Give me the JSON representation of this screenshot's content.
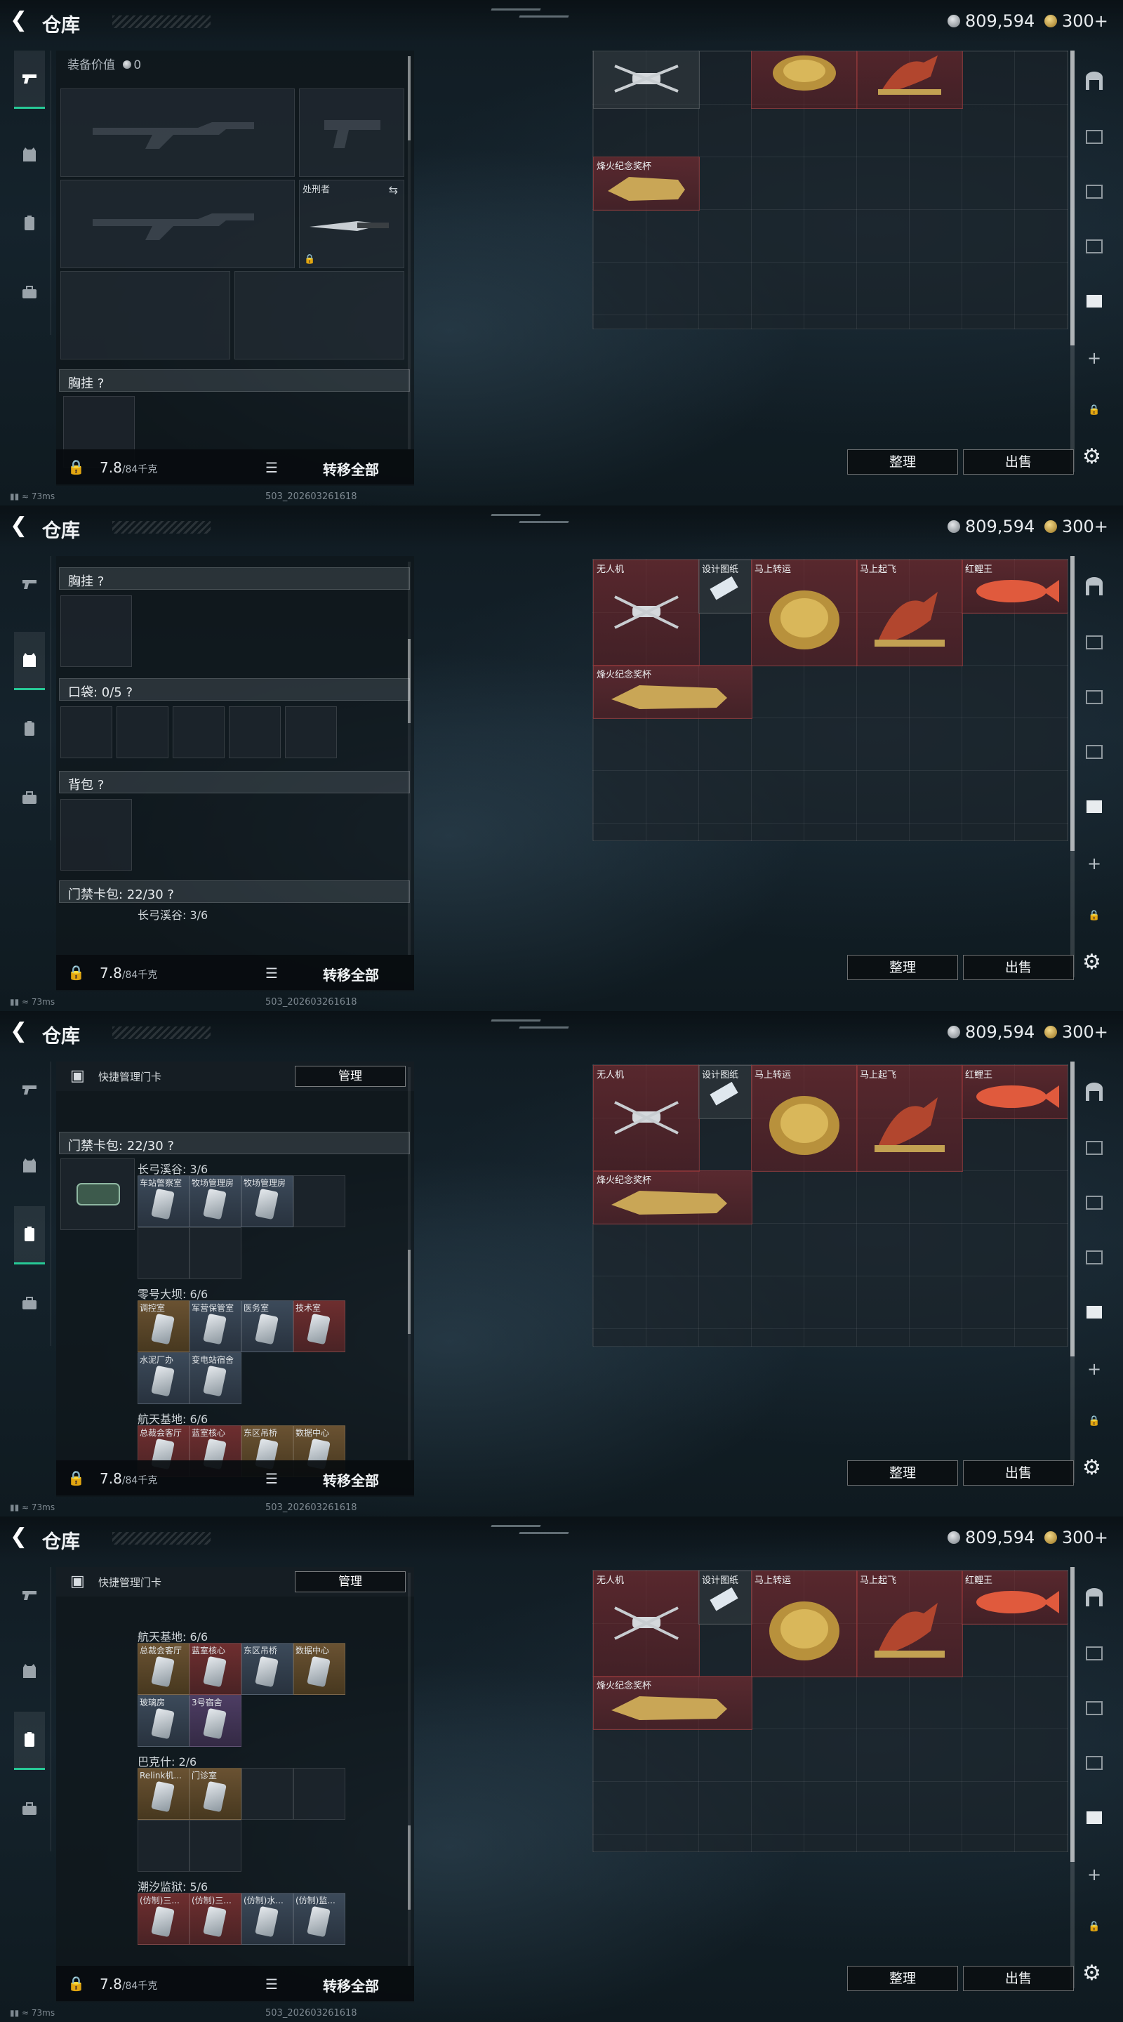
{
  "header": {
    "title": "仓库"
  },
  "currency": {
    "silver": "809,594",
    "gold": "300+"
  },
  "left": {
    "equip_value_label": "装备价值",
    "equip_value": "0",
    "executioner_label": "处刑者",
    "vest_label": "胸挂 ?",
    "pocket_label": "口袋: 0/5 ?",
    "backpack_label": "背包 ?",
    "keycard_label": "门禁卡包: 22/30 ?",
    "quick_manage": "快捷管理门卡",
    "manage_button": "管理",
    "weight": "7.8",
    "weight_unit": "/84千克",
    "transfer_all": "转移全部",
    "groups": {
      "g1": {
        "title": "长弓溪谷: 3/6",
        "cards": [
          "车站警察室",
          "牧场管理房",
          "牧场管理房"
        ]
      },
      "g2": {
        "title": "零号大坝: 6/6",
        "cards": [
          "调控室",
          "军营保管室",
          "医务室",
          "技术室",
          "水泥厂办",
          "变电站宿舍"
        ]
      },
      "g3": {
        "title": "航天基地: 6/6",
        "cards": [
          "总裁会客厅",
          "蓝室核心",
          "东区吊桥",
          "数据中心",
          "玻璃房",
          "3号宿舍"
        ]
      },
      "g4": {
        "title": "巴克什: 2/6",
        "cards": [
          "Relink机...",
          "门诊室"
        ]
      },
      "g5": {
        "title": "潮汐监狱: 5/6",
        "cards": [
          "(仿制)三...",
          "(仿制)三...",
          "(仿制)水...",
          "(仿制)监..."
        ]
      }
    }
  },
  "stash": {
    "items": {
      "drone": "无人机",
      "blueprint": "设计图纸",
      "horse_fortune": "马上转运",
      "horse_fly": "马上起飞",
      "carp": "红鲤王",
      "trophy": "烽火纪念奖杯"
    },
    "sort_button": "整理",
    "sell_button": "出售"
  },
  "status": {
    "ping": "73ms",
    "build": "503_202603261618"
  },
  "colors": {
    "accent": "#27c996",
    "item_red": "#8c2d32",
    "gold": "#d2a84a"
  }
}
